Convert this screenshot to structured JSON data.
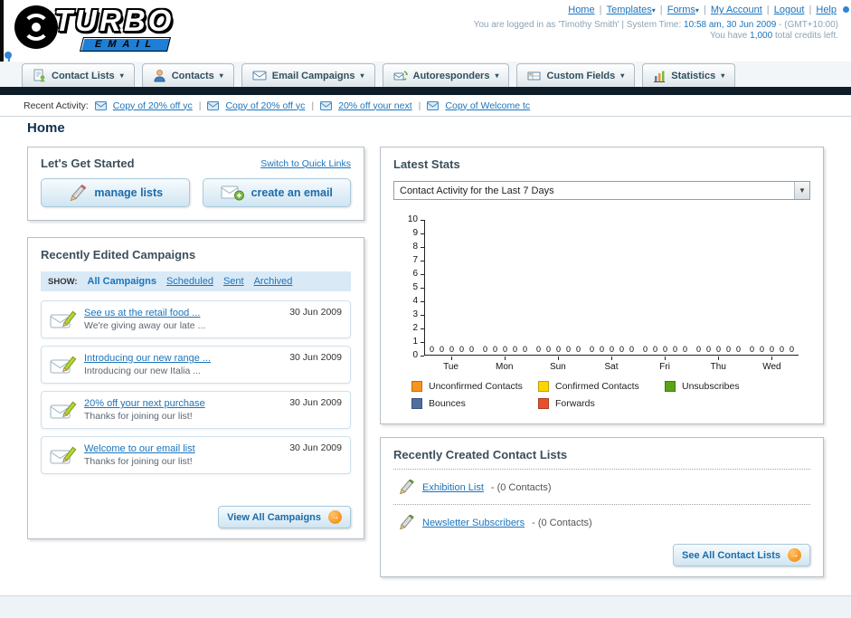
{
  "page": {
    "title": "Home"
  },
  "header": {
    "logo": {
      "word": "TURBO",
      "sub": "EMAIL"
    },
    "top_links": [
      {
        "label": "Home",
        "menu": false
      },
      {
        "label": "Templates",
        "menu": true
      },
      {
        "label": "Forms",
        "menu": true
      },
      {
        "label": "My Account",
        "menu": false
      },
      {
        "label": "Logout",
        "menu": false
      },
      {
        "label": "Help",
        "menu": false
      }
    ],
    "login": {
      "prefix": "You are logged in as 'Timothy Smith' | System Time:",
      "time": "10:58 am, 30 Jun 2009",
      "suffix": "- (GMT+10:00)"
    },
    "credits": {
      "prefix": "You have",
      "amount": "1,000",
      "suffix": "total credits left."
    }
  },
  "nav": {
    "tabs": [
      {
        "label": "Contact Lists",
        "icon": "contact-lists-icon"
      },
      {
        "label": "Contacts",
        "icon": "contacts-icon"
      },
      {
        "label": "Email Campaigns",
        "icon": "email-campaigns-icon"
      },
      {
        "label": "Autoresponders",
        "icon": "autoresponders-icon"
      },
      {
        "label": "Custom Fields",
        "icon": "custom-fields-icon"
      },
      {
        "label": "Statistics",
        "icon": "statistics-icon"
      }
    ]
  },
  "recent_activity": {
    "label": "Recent Activity:",
    "items": [
      "Copy of 20% off yc",
      "Copy of 20% off yc",
      "20% off your next",
      "Copy of Welcome tc"
    ]
  },
  "get_started": {
    "title": "Let's Get Started",
    "switch_link": "Switch to Quick Links",
    "buttons": [
      {
        "label": "manage lists"
      },
      {
        "label": "create an email"
      }
    ]
  },
  "campaigns": {
    "title": "Recently Edited Campaigns",
    "show_label": "SHOW:",
    "filters": [
      "All Campaigns",
      "Scheduled",
      "Sent",
      "Archived"
    ],
    "active_filter": "All Campaigns",
    "items": [
      {
        "title": "See us at the retail food ...",
        "subtitle": "We're giving away our late ...",
        "date": "30 Jun 2009"
      },
      {
        "title": "Introducing our new range ...",
        "subtitle": "Introducing our new Italia ...",
        "date": "30 Jun 2009"
      },
      {
        "title": "20% off your next purchase",
        "subtitle": "Thanks for joining our list!",
        "date": "30 Jun 2009"
      },
      {
        "title": "Welcome to our email list",
        "subtitle": "Thanks for joining our list!",
        "date": "30 Jun 2009"
      }
    ],
    "view_all_label": "View All Campaigns"
  },
  "stats": {
    "title": "Latest Stats",
    "dropdown_value": "Contact Activity for the Last 7 Days",
    "legend": [
      {
        "label": "Unconfirmed Contacts",
        "color": "#f7941d"
      },
      {
        "label": "Confirmed Contacts",
        "color": "#ffd400"
      },
      {
        "label": "Unsubscribes",
        "color": "#5aa317"
      },
      {
        "label": "Bounces",
        "color": "#4f6f9f"
      },
      {
        "label": "Forwards",
        "color": "#e8502d"
      }
    ]
  },
  "chart_data": {
    "type": "bar",
    "title": "Contact Activity for the Last 7 Days",
    "categories": [
      "Tue",
      "Mon",
      "Sun",
      "Sat",
      "Fri",
      "Thu",
      "Wed"
    ],
    "series": [
      {
        "name": "Unconfirmed Contacts",
        "color": "#f7941d",
        "values": [
          0,
          0,
          0,
          0,
          0,
          0,
          0
        ]
      },
      {
        "name": "Confirmed Contacts",
        "color": "#ffd400",
        "values": [
          0,
          0,
          0,
          0,
          0,
          0,
          0
        ]
      },
      {
        "name": "Unsubscribes",
        "color": "#5aa317",
        "values": [
          0,
          0,
          0,
          0,
          0,
          0,
          0
        ]
      },
      {
        "name": "Bounces",
        "color": "#4f6f9f",
        "values": [
          0,
          0,
          0,
          0,
          0,
          0,
          0
        ]
      },
      {
        "name": "Forwards",
        "color": "#e8502d",
        "values": [
          0,
          0,
          0,
          0,
          0,
          0,
          0
        ]
      }
    ],
    "xlabel": "",
    "ylabel": "",
    "ylim": [
      0,
      10
    ],
    "yticks": [
      0,
      1,
      2,
      3,
      4,
      5,
      6,
      7,
      8,
      9,
      10
    ],
    "grid": false,
    "legend_position": "bottom"
  },
  "contact_lists": {
    "title": "Recently Created Contact Lists",
    "items": [
      {
        "name": "Exhibition List",
        "detail": "- (0 Contacts)"
      },
      {
        "name": "Newsletter Subscribers",
        "detail": "- (0 Contacts)"
      }
    ],
    "see_all_label": "See All Contact Lists"
  }
}
